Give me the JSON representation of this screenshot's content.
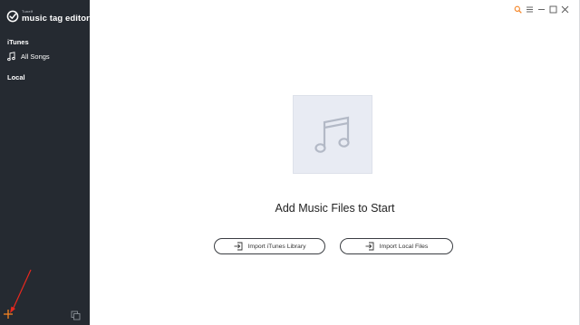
{
  "app": {
    "brand": "Tunelf",
    "name": "music tag editor"
  },
  "sidebar": {
    "sections": [
      {
        "label": "iTunes",
        "items": [
          {
            "label": "All Songs",
            "icon": "music-note-icon"
          }
        ]
      },
      {
        "label": "Local",
        "items": []
      }
    ],
    "add_icon": "plus-icon",
    "copy_icon": "copy-icon"
  },
  "titlebar": {
    "icons": [
      "search-icon",
      "menu-icon",
      "minimize-icon",
      "maximize-icon",
      "close-icon"
    ]
  },
  "main": {
    "placeholder_icon": "music-note-icon",
    "heading": "Add Music Files to Start",
    "buttons": [
      {
        "label": "Import iTunes Library",
        "icon": "import-icon"
      },
      {
        "label": "Import Local Files",
        "icon": "import-icon"
      }
    ]
  },
  "colors": {
    "sidebar_bg": "#252a31",
    "accent": "#f58220",
    "annotation_arrow": "#e8281e",
    "placeholder_bg": "#e8ebf3"
  }
}
